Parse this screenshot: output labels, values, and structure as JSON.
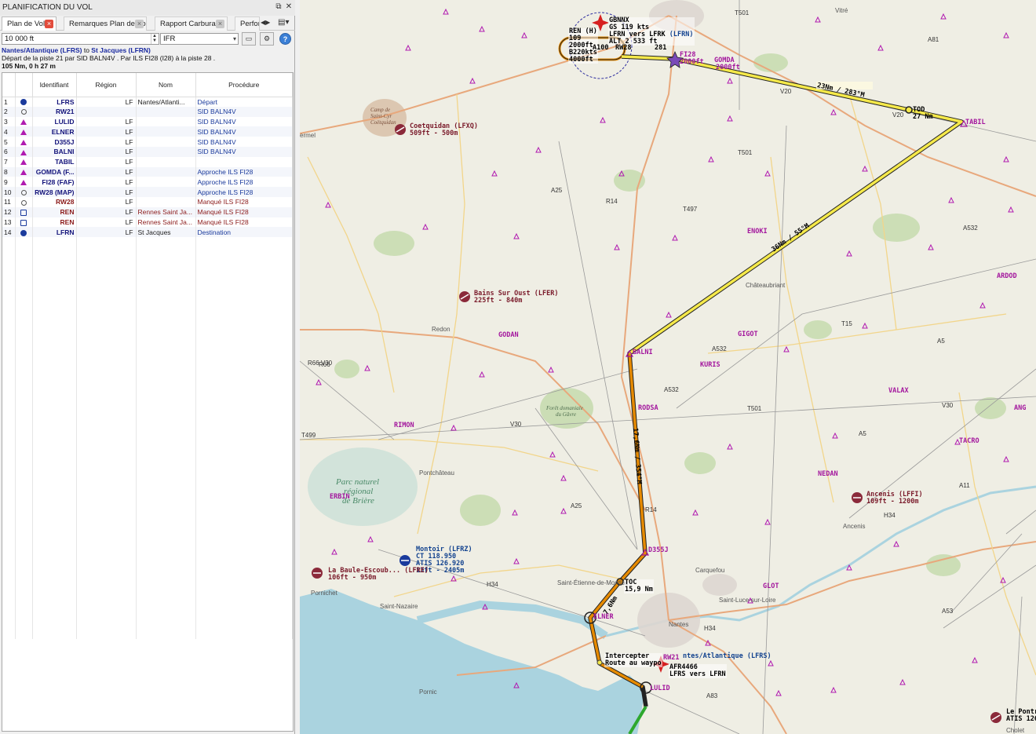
{
  "panel": {
    "title": "PLANIFICATION DU VOL",
    "tabs": [
      {
        "label": "Plan de Vol *"
      },
      {
        "label": "Remarques Plan de Vol"
      },
      {
        "label": "Rapport Carburant"
      },
      {
        "label": "Perfor"
      }
    ],
    "altitude": "10 000 ft",
    "flight_rules": "IFR",
    "route_line1_dep": "Nantes/Atlantique (LFRS)",
    "route_line1_to": " to ",
    "route_line1_dest": "St Jacques (LFRN)",
    "route_line2": "Départ de la piste 21 par SID BALN4V . Par ILS FI28 (I28) à la piste 28 .",
    "route_line3": "105 Nm, 0 h 27 m"
  },
  "table": {
    "headers": [
      "Identifiant",
      "Région",
      "Nom",
      "Procédure"
    ],
    "rows": [
      {
        "n": "1",
        "icon": "airport-icon",
        "id": "LFRS",
        "region": "LF",
        "name": "Nantes/Atlanti...",
        "proc": "Départ",
        "red": false
      },
      {
        "n": "2",
        "icon": "runway-waypoint-icon",
        "id": "RW21",
        "region": "",
        "name": "",
        "proc": "SID BALN4V",
        "red": false
      },
      {
        "n": "3",
        "icon": "waypoint-icon",
        "id": "LULID",
        "region": "LF",
        "name": "",
        "proc": "SID BALN4V",
        "red": false
      },
      {
        "n": "4",
        "icon": "waypoint-icon",
        "id": "ELNER",
        "region": "LF",
        "name": "",
        "proc": "SID BALN4V",
        "red": false
      },
      {
        "n": "5",
        "icon": "waypoint-icon",
        "id": "D355J",
        "region": "LF",
        "name": "",
        "proc": "SID BALN4V",
        "red": false
      },
      {
        "n": "6",
        "icon": "waypoint-icon",
        "id": "BALNI",
        "region": "LF",
        "name": "",
        "proc": "SID BALN4V",
        "red": false
      },
      {
        "n": "7",
        "icon": "waypoint-icon",
        "id": "TABIL",
        "region": "LF",
        "name": "",
        "proc": "",
        "red": false
      },
      {
        "n": "8",
        "icon": "waypoint-icon",
        "id": "GOMDA (F...",
        "region": "LF",
        "name": "",
        "proc": "Approche ILS FI28",
        "red": false
      },
      {
        "n": "9",
        "icon": "waypoint-icon",
        "id": "FI28 (FAF)",
        "region": "LF",
        "name": "",
        "proc": "Approche ILS FI28",
        "red": false
      },
      {
        "n": "10",
        "icon": "runway-waypoint-icon",
        "id": "RW28 (MAP)",
        "region": "LF",
        "name": "",
        "proc": "Approche ILS FI28",
        "red": false
      },
      {
        "n": "11",
        "icon": "runway-waypoint-icon",
        "id": "RW28",
        "region": "LF",
        "name": "",
        "proc": "Manqué ILS FI28",
        "red": true
      },
      {
        "n": "12",
        "icon": "vor-icon",
        "id": "REN",
        "region": "LF",
        "name": "Rennes Saint Ja...",
        "proc": "Manqué ILS FI28",
        "red": true
      },
      {
        "n": "13",
        "icon": "vor-icon",
        "id": "REN",
        "region": "LF",
        "name": "Rennes Saint Ja...",
        "proc": "Manqué ILS FI28",
        "red": true
      },
      {
        "n": "14",
        "icon": "destination-airport-icon",
        "id": "LFRN",
        "region": "LF",
        "name": "St Jacques",
        "proc": "Destination",
        "red": false
      }
    ]
  },
  "map": {
    "waypoints": [
      "GOMDA",
      "TABIL",
      "ENOKI",
      "ARDOD",
      "GODAN",
      "BALNI",
      "GIGOT",
      "KURIS",
      "VALAX",
      "RODSA",
      "ANG",
      "RIMON",
      "TACRO",
      "NEDAN",
      "ERBIN",
      "D355J",
      "GLOT",
      "ELNER",
      "LULID"
    ],
    "gomda_alt": "2000ft",
    "fi28_label": "FI28",
    "fi28_alt": "2000ft",
    "airports": {
      "coetquidan": "Coetquidan (LFXQ)",
      "coetquidan_info": "509ft - 500m",
      "bains": "Bains Sur Oust (LFER)",
      "bains_info": "225ft - 840m",
      "ancenis": "Ancenis (LFFI)",
      "ancenis_info": "109ft - 1200m",
      "montoir": "Montoir (LFRZ)",
      "montoir_ct": "CT 118.950",
      "montoir_atis": "ATIS 126.920",
      "montoir_info": "13ft - 2405m",
      "labaule": "La Baule-Escoub... (LFRE)",
      "labaule_info": "106ft - 950m",
      "nantes": "ntes/Atlantique (LFRS)",
      "pontre": "Le Pontre",
      "pontre_atis": "ATIS 126"
    },
    "aircraft1": {
      "callsign": "GBNNX",
      "gs": "GS 119 kts",
      "alt": "ALT 2 533 ft",
      "route": "LFRN vers LFRK"
    },
    "aircraft2": {
      "callsign": "AFR4466",
      "route": "LFRS vers LFRN"
    },
    "hold": {
      "nav": "REN (H)",
      "crs": "109",
      "alt": "2000ft",
      "speed": "B220kts",
      "alt2": "4000ft"
    },
    "legs": [
      {
        "label": "23Nm / 283°M"
      },
      {
        "label": "36Nm / 55°M"
      },
      {
        "label": "17,6Nm / 354°M"
      },
      {
        "label": "7,6Nm"
      },
      {
        "label": "281"
      }
    ],
    "tod": "TOD",
    "tod_dist": "27 Nm",
    "toc": "TOC",
    "toc_dist": "15,9 Nm",
    "intercept": "Intercepter",
    "intercept2": "Route au waypo",
    "rw21": "RW21",
    "lfrn": "(LFRN)",
    "a100": "A100",
    "rw28": "RW28",
    "towns": [
      "Vitré",
      "Châteaubriant",
      "Redon",
      "Pontchâteau",
      "Ancenis",
      "Carquefou",
      "Nantes",
      "Saint-Nazaire",
      "Pornichet",
      "Pornic",
      "Saint-Luce-sur-Loire",
      "Saint-Étienne-de-Montluc",
      "Cholet",
      "ermel"
    ],
    "airways": [
      "V20",
      "V20",
      "V30",
      "V30",
      "A5",
      "A5",
      "R14",
      "R14",
      "A25",
      "A25",
      "T15",
      "A532",
      "A532",
      "A532",
      "H34",
      "H34",
      "R66",
      "R66 V30",
      "T499",
      "T497",
      "T501",
      "T501",
      "T501",
      "A11",
      "A81",
      "A83",
      "H34",
      "A53"
    ],
    "park": [
      "Parc naturel",
      "régional",
      "de Brière"
    ],
    "forest": [
      "Forêt domaniale",
      "du Gâvre"
    ],
    "camp": [
      "Camp de",
      "Saint-Cyr",
      "Coëtquidan"
    ]
  }
}
